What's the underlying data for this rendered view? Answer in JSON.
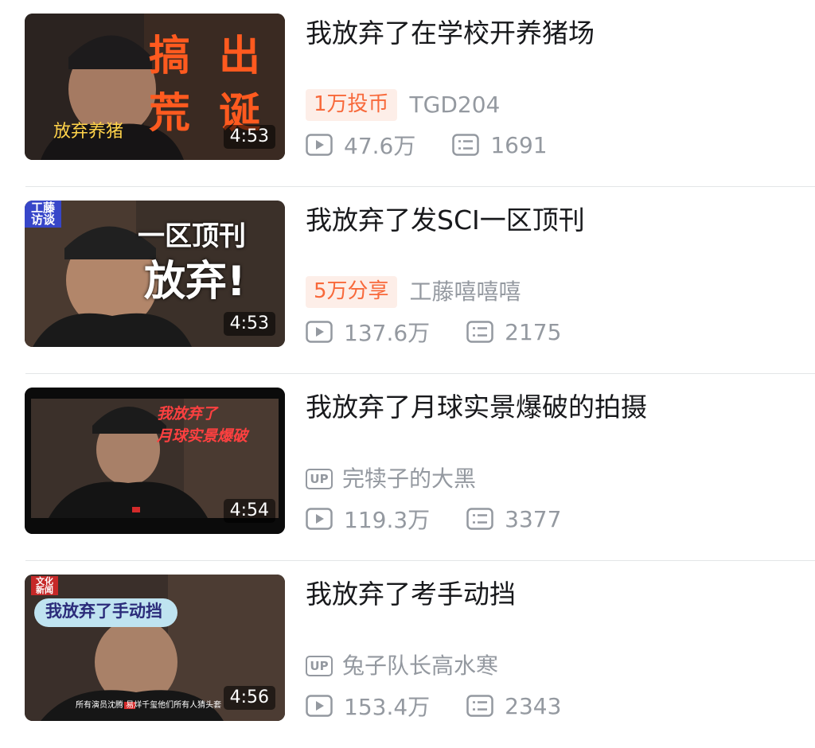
{
  "icons": {
    "play": "play-count-icon",
    "danmaku": "danmaku-icon",
    "up": "uploader-tag-icon"
  },
  "colors": {
    "badge_text": "#f8693b",
    "badge_bg": "#fdeee8",
    "meta": "#9499a0",
    "title": "#18191c"
  },
  "videos": [
    {
      "title": "我放弃了在学校开养猪场",
      "duration": "4:53",
      "badge": "1万投币",
      "author": "TGD204",
      "views": "47.6万",
      "danmaku": "1691",
      "thumb_text": {
        "a": "搞",
        "b": "出",
        "c": "荒",
        "d": "诞",
        "caption": "放弃养猪"
      }
    },
    {
      "title": "我放弃了发SCI一区顶刊",
      "duration": "4:53",
      "badge": "5万分享",
      "author": "工藤嘻嘻嘻",
      "views": "137.6万",
      "danmaku": "2175",
      "thumb_text": {
        "corner": "工藤访谈",
        "line1": "一区顶刊",
        "line2": "放弃!"
      }
    },
    {
      "title": "我放弃了月球实景爆破的拍摄",
      "duration": "4:54",
      "up_label": "UP",
      "author": "完犊子的大黑",
      "views": "119.3万",
      "danmaku": "3377",
      "thumb_text": {
        "line1": "我放弃了",
        "line2": "月球实景爆破"
      }
    },
    {
      "title": "我放弃了考手动挡",
      "duration": "4:56",
      "up_label": "UP",
      "author": "兔子队长高水寒",
      "views": "153.4万",
      "danmaku": "2343",
      "thumb_text": {
        "corner": "文化新闻",
        "bubble": "我放弃了手动挡",
        "subtitle": "所有演员沈腾 易烊千玺他们所有人猜头套"
      }
    }
  ]
}
